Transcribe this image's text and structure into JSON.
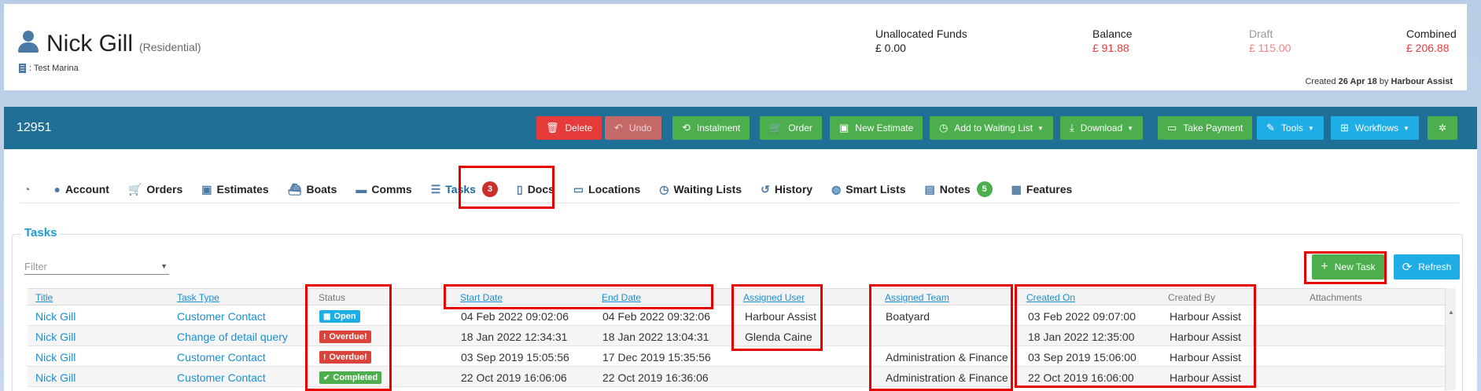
{
  "customer": {
    "name": "Nick Gill",
    "type": "(Residential)",
    "marina": ": Test Marina"
  },
  "finance": {
    "unallocated_label": "Unallocated Funds",
    "unallocated_value": "£ 0.00",
    "balance_label": "Balance",
    "balance_value": "£ 91.88",
    "draft_label": "Draft",
    "draft_value": "£ 115.00",
    "combined_label": "Combined",
    "combined_value": "£ 206.88",
    "colors": {
      "negative": "#e53b3b",
      "draft": "#f08585",
      "draft_label": "#999999"
    }
  },
  "created": {
    "prefix": "Created",
    "date": "26 Apr 18",
    "by": "by",
    "user": "Harbour Assist"
  },
  "toolbar": {
    "record_id": "12951",
    "buttons": [
      {
        "label": "Delete",
        "icon": "trash-icon"
      },
      {
        "label": "Undo",
        "icon": "undo-icon"
      },
      {
        "label": "Instalment",
        "icon": "instalment-icon"
      },
      {
        "label": "Order",
        "icon": "cart-icon"
      },
      {
        "label": "New Estimate",
        "icon": "estimate-icon"
      },
      {
        "label": "Add to Waiting List",
        "icon": "clock-icon"
      },
      {
        "label": "Download",
        "icon": "download-icon"
      },
      {
        "label": "Take Payment",
        "icon": "card-icon"
      },
      {
        "label": "Tools",
        "icon": "wand-icon"
      },
      {
        "label": "Workflows",
        "icon": "workflow-icon"
      },
      {
        "label": "",
        "icon": "gear-icon"
      }
    ]
  },
  "tabs": [
    {
      "label": "",
      "icon": "dashboard-icon"
    },
    {
      "label": "Account",
      "icon": "user-icon"
    },
    {
      "label": "Orders",
      "icon": "cart-icon"
    },
    {
      "label": "Estimates",
      "icon": "estimate-icon"
    },
    {
      "label": "Boats",
      "icon": "boat-icon"
    },
    {
      "label": "Comms",
      "icon": "comments-icon"
    },
    {
      "label": "Tasks",
      "icon": "tasks-icon",
      "badge": "3"
    },
    {
      "label": "Docs",
      "icon": "document-icon"
    },
    {
      "label": "Locations",
      "icon": "bed-icon"
    },
    {
      "label": "Waiting Lists",
      "icon": "clock-icon"
    },
    {
      "label": "History",
      "icon": "history-icon"
    },
    {
      "label": "Smart Lists",
      "icon": "bulb-icon"
    },
    {
      "label": "Notes",
      "icon": "note-icon",
      "badge": "5"
    },
    {
      "label": "Features",
      "icon": "grid-icon"
    }
  ],
  "tasks": {
    "title": "Tasks",
    "filter_placeholder": "Filter",
    "new_task_label": "New Task",
    "refresh_label": "Refresh",
    "columns": [
      "Title",
      "Task Type",
      "Status",
      "Start Date",
      "End Date",
      "Assigned User",
      "Assigned Team",
      "Created On",
      "Created By",
      "Attachments"
    ],
    "rows": [
      {
        "title": "Nick Gill",
        "type": "Customer Contact",
        "status": "Open",
        "start": "04 Feb 2022 09:02:06",
        "end": "04 Feb 2022 09:32:06",
        "user": "Harbour Assist",
        "team": "Boatyard",
        "created_on": "03 Feb 2022 09:07:00",
        "created_by": "Harbour Assist"
      },
      {
        "title": "Nick Gill",
        "type": "Change of detail query",
        "status": "Overdue!",
        "start": "18 Jan 2022 12:34:31",
        "end": "18 Jan 2022 13:04:31",
        "user": "Glenda Caine",
        "team": "",
        "created_on": "18 Jan 2022 12:35:00",
        "created_by": "Harbour Assist"
      },
      {
        "title": "Nick Gill",
        "type": "Customer Contact",
        "status": "Overdue!",
        "start": "03 Sep 2019 15:05:56",
        "end": "17 Dec 2019 15:35:56",
        "user": "",
        "team": "Administration & Finance",
        "created_on": "03 Sep 2019 15:06:00",
        "created_by": "Harbour Assist"
      },
      {
        "title": "Nick Gill",
        "type": "Customer Contact",
        "status": "Completed",
        "start": "22 Oct 2019 16:06:06",
        "end": "22 Oct 2019 16:36:06",
        "user": "",
        "team": "Administration & Finance",
        "created_on": "22 Oct 2019 16:06:00",
        "created_by": "Harbour Assist"
      }
    ],
    "status_colors": {
      "Open": "#1eaee5",
      "Overdue!": "#d9433a",
      "Completed": "#4cae4c"
    }
  }
}
